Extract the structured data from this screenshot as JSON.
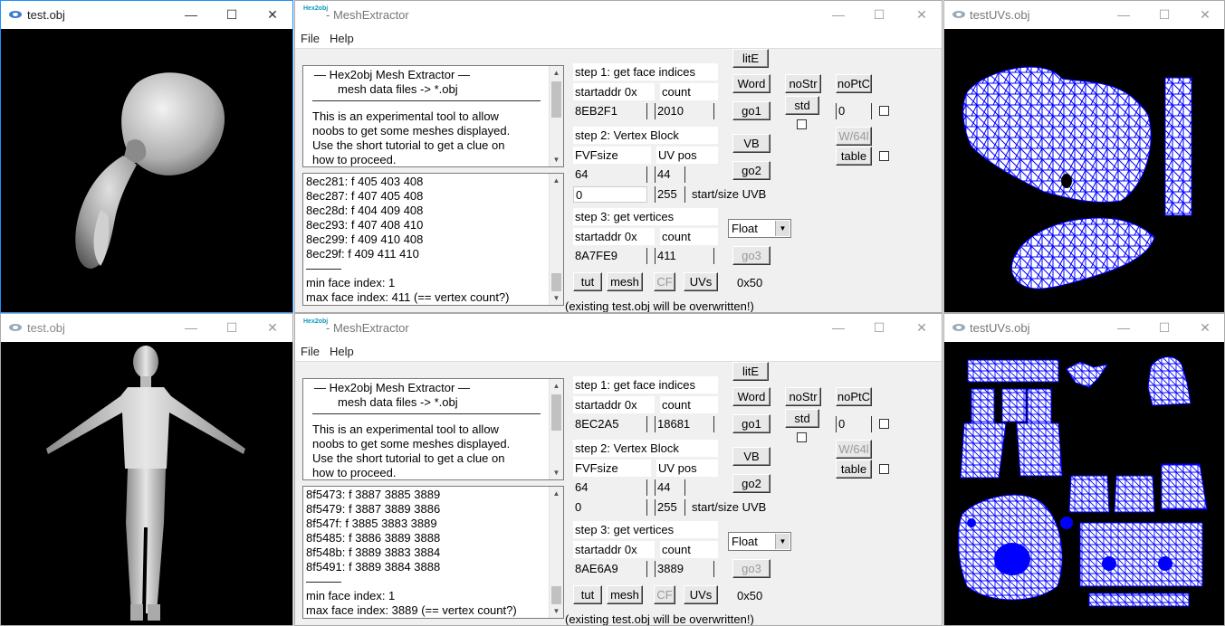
{
  "app_icon_text": "Hex2obj",
  "obj_windows": [
    {
      "title": "test.obj"
    },
    {
      "title": "test.obj"
    }
  ],
  "uv_windows": [
    {
      "title": "testUVs.obj"
    },
    {
      "title": "testUVs.obj"
    }
  ],
  "controls": {
    "minimize": "—",
    "maximize": "☐",
    "close": "✕"
  },
  "mesh_windows": [
    {
      "title": "- MeshExtractor",
      "menu": [
        "File",
        "Help"
      ],
      "info": {
        "heading1": "—   Hex2obj Mesh Extractor   —",
        "heading2": "mesh data files -> *.obj",
        "lines": [
          "This is an experimental tool to allow",
          "noobs to get some meshes displayed.",
          "Use the short tutorial to get a clue on",
          "how to proceed."
        ]
      },
      "log": {
        "lines": [
          "8ec281: f  405 403 408",
          "8ec287: f  407 405 408",
          "8ec28d: f  404 409 408",
          "8ec293: f  407 408 410",
          "8ec299: f  409 410 408",
          "8ec29f: f  409 411 410"
        ],
        "sep": "———",
        "min_line": "min face index: 1",
        "max_line": "max face index: 411 (== vertex count?)"
      },
      "step1": {
        "label": "step 1: get face indices",
        "addr_label": "startaddr 0x",
        "count_label": "count",
        "addr": "8EB2F1",
        "count": "2010"
      },
      "step2": {
        "label": "step 2: Vertex Block",
        "fvf_label": "FVFsize",
        "uvpos_label": "UV pos",
        "fvf": "64",
        "uvpos": "44",
        "uvb_start": "0",
        "uvb_size": "255",
        "uvb_label": "start/size UVB"
      },
      "step3": {
        "label": "step 3: get vertices",
        "addr_label": "startaddr 0x",
        "count_label": "count",
        "addr": "8A7FE9",
        "count": "411"
      },
      "buttons": {
        "lite": "litE",
        "word": "Word",
        "go1": "go1",
        "vb": "VB",
        "go2": "go2",
        "go3": "go3",
        "nostr": "noStr",
        "std": "std",
        "noptc": "noPtC",
        "w64": "W/64l",
        "table": "table",
        "tut": "tut",
        "mesh": "mesh",
        "cf": "CF",
        "uvs": "UVs"
      },
      "ptc_value": "0",
      "format": "Float",
      "hex_label": "0x50",
      "warning": "(existing test.obj will be overwritten!)"
    },
    {
      "title": "- MeshExtractor",
      "menu": [
        "File",
        "Help"
      ],
      "info": {
        "heading1": "—   Hex2obj Mesh Extractor   —",
        "heading2": "mesh data files -> *.obj",
        "lines": [
          "This is an experimental tool to allow",
          "noobs to get some meshes displayed.",
          "Use the short tutorial to get a clue on",
          "how to proceed."
        ]
      },
      "log": {
        "lines": [
          "8f5473: f  3887 3885 3889",
          "8f5479: f  3887 3889 3886",
          "8f547f: f  3885 3883 3889",
          "8f5485: f  3886 3889 3888",
          "8f548b: f  3889 3883 3884",
          "8f5491: f  3889 3884 3888"
        ],
        "sep": "———",
        "min_line": "min face index: 1",
        "max_line": "max face index: 3889 (== vertex count?)"
      },
      "step1": {
        "label": "step 1: get face indices",
        "addr_label": "startaddr 0x",
        "count_label": "count",
        "addr": "8EC2A5",
        "count": "18681"
      },
      "step2": {
        "label": "step 2: Vertex Block",
        "fvf_label": "FVFsize",
        "uvpos_label": "UV pos",
        "fvf": "64",
        "uvpos": "44",
        "uvb_start": "0",
        "uvb_size": "255",
        "uvb_label": "start/size UVB"
      },
      "step3": {
        "label": "step 3: get vertices",
        "addr_label": "startaddr 0x",
        "count_label": "count",
        "addr": "8AE6A9",
        "count": "3889"
      },
      "buttons": {
        "lite": "litE",
        "word": "Word",
        "go1": "go1",
        "vb": "VB",
        "go2": "go2",
        "go3": "go3",
        "nostr": "noStr",
        "std": "std",
        "noptc": "noPtC",
        "w64": "W/64l",
        "table": "table",
        "tut": "tut",
        "mesh": "mesh",
        "cf": "CF",
        "uvs": "UVs"
      },
      "ptc_value": "0",
      "format": "Float",
      "hex_label": "0x50",
      "warning": "(existing test.obj will be overwritten!)"
    }
  ],
  "colors": {
    "uv_mesh": "#0000ff",
    "viewport_bg": "#000000",
    "model": "#c8c8c8"
  }
}
